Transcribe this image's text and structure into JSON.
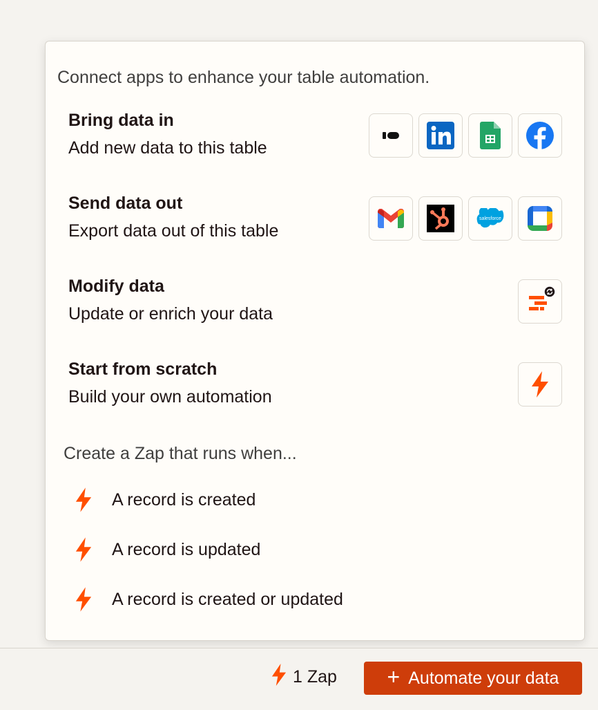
{
  "popover": {
    "intro": "Connect apps to enhance your table automation.",
    "rows": [
      {
        "title": "Bring data in",
        "desc": "Add new data to this table",
        "apps": [
          "intercom-icon",
          "linkedin-icon",
          "google-sheets-icon",
          "facebook-icon"
        ]
      },
      {
        "title": "Send data out",
        "desc": "Export data out of this table",
        "apps": [
          "gmail-icon",
          "hubspot-icon",
          "salesforce-icon",
          "google-calendar-icon"
        ]
      },
      {
        "title": "Modify data",
        "desc": "Update or enrich your data",
        "apps": [
          "formatter-icon"
        ]
      },
      {
        "title": "Start from scratch",
        "desc": "Build your own automation",
        "apps": [
          "zap-bolt-icon"
        ]
      }
    ],
    "section_label": "Create a Zap that runs when...",
    "triggers": [
      {
        "label": "A record is created"
      },
      {
        "label": "A record is updated"
      },
      {
        "label": "A record is created or updated"
      }
    ],
    "salesforce_wordmark": "salesforce"
  },
  "footer": {
    "zap_count": "1 Zap",
    "cta_plus": "+",
    "cta_label": "Automate your data"
  },
  "colors": {
    "accent": "#ff4f00",
    "cta_bg": "#ce3d0a",
    "background": "#f5f3ef"
  }
}
